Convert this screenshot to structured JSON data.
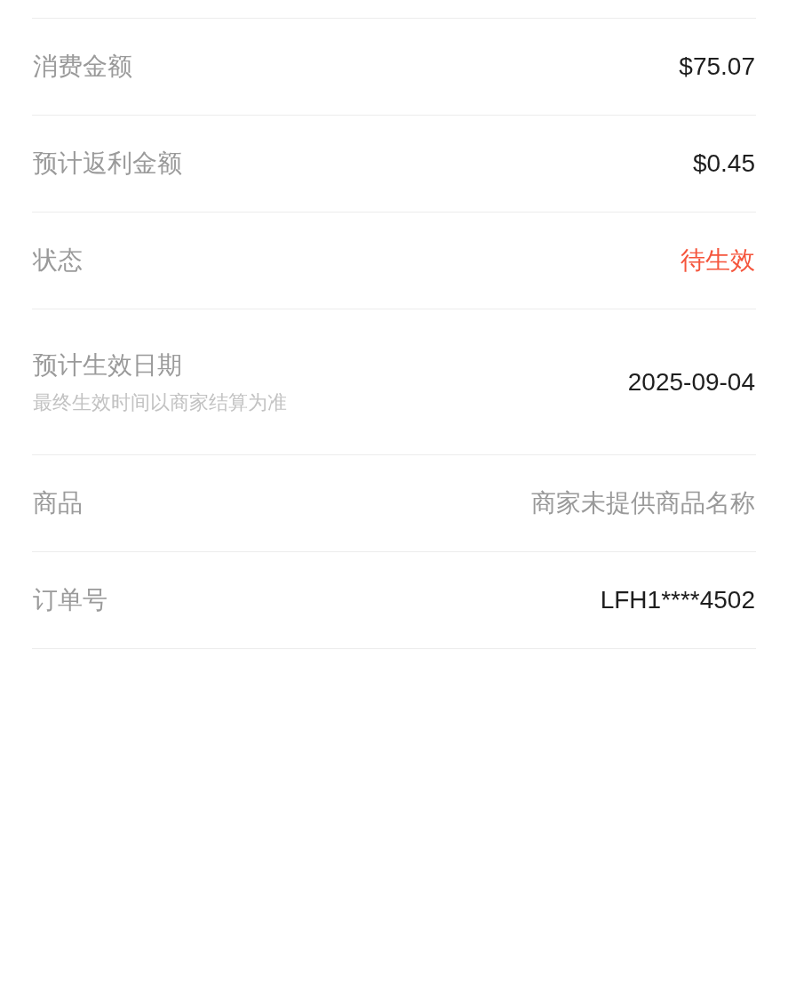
{
  "rows": [
    {
      "label": "消费金额",
      "value": "$75.07",
      "kind": "plain"
    },
    {
      "label": "预计返利金额",
      "value": "$0.45",
      "kind": "plain"
    },
    {
      "label": "状态",
      "value": "待生效",
      "kind": "status"
    },
    {
      "label": "预计生效日期",
      "note": "最终生效时间以商家结算为准",
      "value": "2025-09-04",
      "kind": "plain"
    },
    {
      "label": "商品",
      "placeholder": "商家未提供商品名称",
      "kind": "plain"
    },
    {
      "label": "订单号",
      "value": "LFH1****4502",
      "kind": "plain"
    }
  ]
}
